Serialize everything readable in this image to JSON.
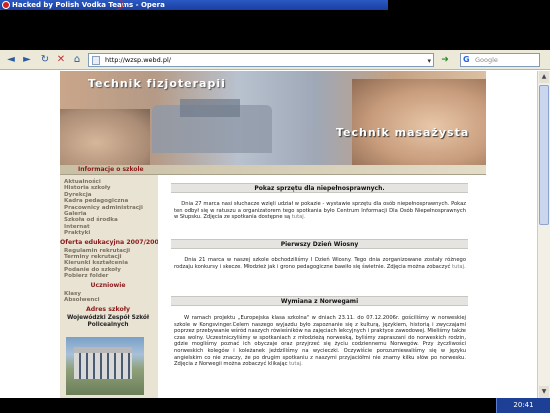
{
  "window": {
    "title": "Hacked by Polish Vodka Teams - Opera"
  },
  "toolbar": {
    "back_glyph": "◄",
    "forward_glyph": "►",
    "reload_glyph": "↻",
    "stop_glyph": "✕",
    "home_glyph": "⌂",
    "url": "http://wzsp.webd.pl/",
    "go_glyph": "➜",
    "search_placeholder": "Google",
    "search_engine_glyph": "G"
  },
  "banner": {
    "title_left": "Technik fizjoterapii",
    "title_right": "Technik masażysta"
  },
  "section": {
    "label": "Informacje o szkole"
  },
  "sidebar": {
    "group1": [
      "Aktualności",
      "Historia szkoły",
      "Dyrekcja",
      "Kadra pedagogiczna",
      "Pracownicy administracji",
      "Galeria",
      "Szkoła od środka",
      "Internat",
      "Praktyki"
    ],
    "group2_head": "Oferta edukacyjna 2007/2008",
    "group2": [
      "Regulamin rekrutacji",
      "Terminy rekrutacji",
      "Kierunki kształcenia",
      "Podanie do szkoły",
      "Pobierz folder"
    ],
    "group3_head": "Uczniowie",
    "group3": [
      "Klasy",
      "Absolwenci"
    ],
    "group4_head": "Adres szkoły",
    "school_name": "Wojewódzki Zespół Szkół Policealnych"
  },
  "articles": [
    {
      "title": "Pokaz sprzętu dla niepełnosprawnych.",
      "body": "Dnia 27 marca nasi słuchacze wzięli udział w pokazie - wystawie sprzętu dla osób niepełnosprawnych. Pokaz ten odbył się w ratuszu a organizatorem tego spotkania było Centrum Informacji Dla Osób Niepełnosprawnych w Słupsku. Zdjęcia ze spotkania dostępne są",
      "more": "tutaj."
    },
    {
      "title": "Pierwszy Dzień Wiosny",
      "body": "Dnia 21 marca w naszej szkole obchodziliśmy I Dzień Wiosny. Tego dnia zorganizowane zostały różnego rodzaju konkursy i skecze. Młodzież jak i grono pedagogiczne bawiło się świetnie. Zdjęcia można zobaczyć",
      "more": "tutaj."
    },
    {
      "title": "Wymiana z Norwegami",
      "body": "W ramach projektu „Europejska klasa szkolna\" w dniach 23.11. do 07.12.2006r. gościliśmy w norweskiej szkole w Kongsvinger.Celem naszego wyjazdu było zapoznanie się z kulturą, językiem, historią i zwyczajami poprzez przebywanie wśród naszych rówieśników na zajęciach lekcyjnych i praktyce zawodowej. Mieliśmy także czas wolny. Uczestniczyliśmy w spotkaniach z młodzieżą norweską, byliśmy zapraszani do norweskich rodzin, gdzie mogliśmy poznać ich obyczaje oraz przyjrzeć się życiu codziennemu Norwegów. Przy życzliwości norweskich kolegów i koleżanek jeździliśmy na wycieczki. Oczywiście porozumiewaliśmy się w języku angielskim co nie znaczy, że po drugim spotkaniu z naszymi przyjaciółmi nie znamy kilku słów po norwesku. Zdjęcia z Norwegii można zobaczyć klikając",
      "more": "tutaj."
    }
  ],
  "taskbar": {
    "clock": "20:41"
  }
}
